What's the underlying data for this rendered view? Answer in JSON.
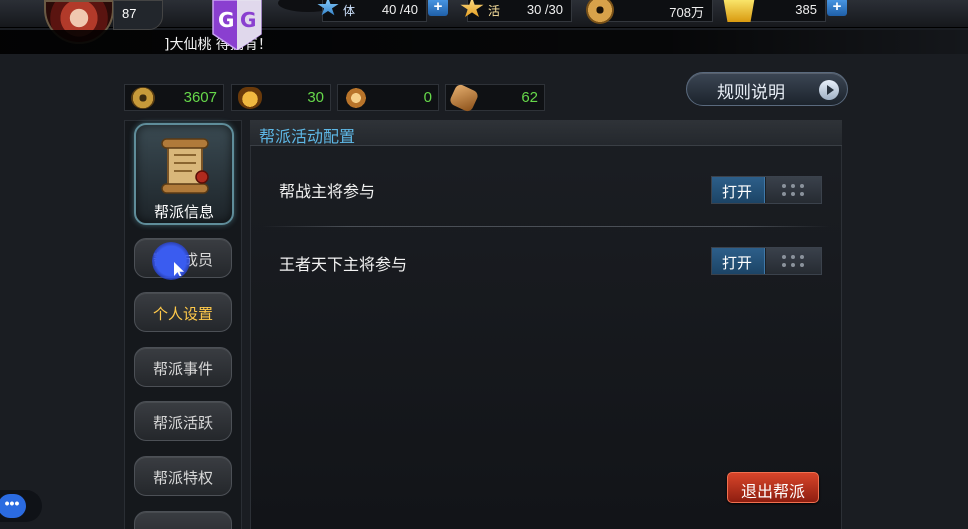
{
  "hud": {
    "level": "87",
    "gg_icon": "gg-badge-icon",
    "resources": [
      {
        "id": "energy",
        "label": "体",
        "value": "40 /40",
        "icon": "blue-star-icon",
        "has_plus": true
      },
      {
        "id": "vitality",
        "label": "活",
        "value": "30 /30",
        "icon": "gold-star-icon",
        "has_plus": false
      },
      {
        "id": "coin",
        "label": "",
        "value": "708万",
        "icon": "copper-coin-icon",
        "has_plus": false
      },
      {
        "id": "gold",
        "label": "",
        "value": "385",
        "icon": "gold-ingot-icon",
        "has_plus": true
      }
    ],
    "plus_label": "+"
  },
  "marquee": {
    "text": "]大仙桃      得拥有！"
  },
  "stats": [
    {
      "icon": "guild-coin-icon",
      "value": "3607"
    },
    {
      "icon": "beast-mask-icon",
      "value": "30"
    },
    {
      "icon": "star-medal-icon",
      "value": "0"
    },
    {
      "icon": "token-icon",
      "value": "62"
    }
  ],
  "rules_button": {
    "label": "规则说明"
  },
  "menu": [
    {
      "label": "帮派信息",
      "state": "active",
      "icon": "scroll-icon"
    },
    {
      "label": "帮派成员",
      "state": "normal"
    },
    {
      "label": "个人设置",
      "state": "selected"
    },
    {
      "label": "帮派事件",
      "state": "normal"
    },
    {
      "label": "帮派活跃",
      "state": "normal"
    },
    {
      "label": "帮派特权",
      "state": "normal"
    }
  ],
  "panel": {
    "title": "帮派活动配置",
    "settings": [
      {
        "label": "帮战主将参与",
        "toggle": "打开"
      },
      {
        "label": "王者天下主将参与",
        "toggle": "打开"
      }
    ],
    "exit_button": "退出帮派"
  },
  "colors": {
    "stat_value": "#66d84a",
    "panel_title": "#5eb8e6",
    "selected_menu_text": "#ffc94a",
    "exit_button": "#c0341e",
    "toggle_on": "#2d5f8a"
  },
  "chat": {
    "label": "•••"
  }
}
